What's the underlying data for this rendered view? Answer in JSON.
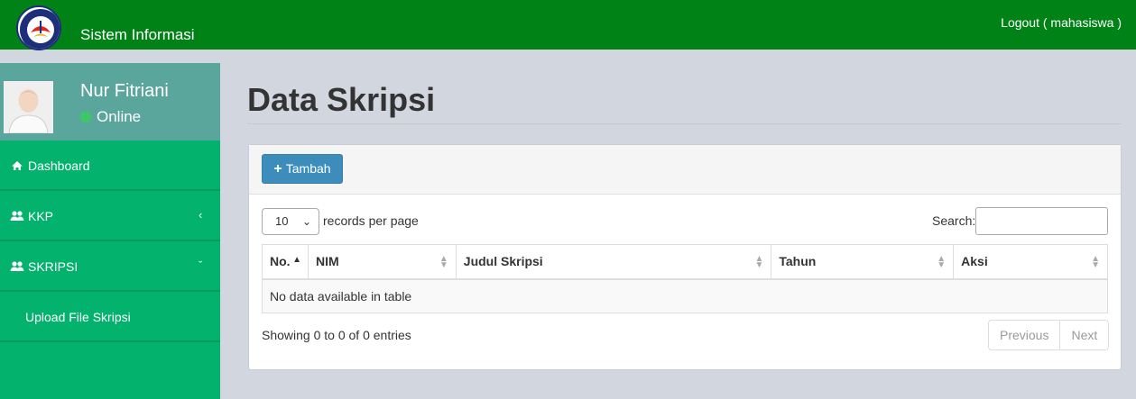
{
  "header": {
    "brand": "Sistem Informasi",
    "logout": "Logout ( mahasiswa )",
    "bg_color": "#008217"
  },
  "sidebar": {
    "user": {
      "name": "Nur Fitriani",
      "status": "Online"
    },
    "items": [
      {
        "label": "Dashboard",
        "icon": "home-icon"
      },
      {
        "label": "KKP",
        "icon": "users-icon",
        "arrow": "‹"
      },
      {
        "label": "SKRIPSI",
        "icon": "users-icon",
        "arrow": "ˇ"
      }
    ],
    "submenu": [
      {
        "label": "Upload File Skripsi"
      }
    ],
    "bg_color": "#03b26d"
  },
  "main": {
    "title": "Data Skripsi",
    "add_button": "Tambah",
    "length": {
      "value": "10",
      "label": "records per page"
    },
    "search": {
      "label": "Search:",
      "value": ""
    },
    "table": {
      "columns": [
        "No.",
        "NIM",
        "Judul Skripsi",
        "Tahun",
        "Aksi"
      ],
      "empty_message": "No data available in table"
    },
    "info": "Showing 0 to 0 of 0 entries",
    "pagination": {
      "previous": "Previous",
      "next": "Next"
    }
  }
}
